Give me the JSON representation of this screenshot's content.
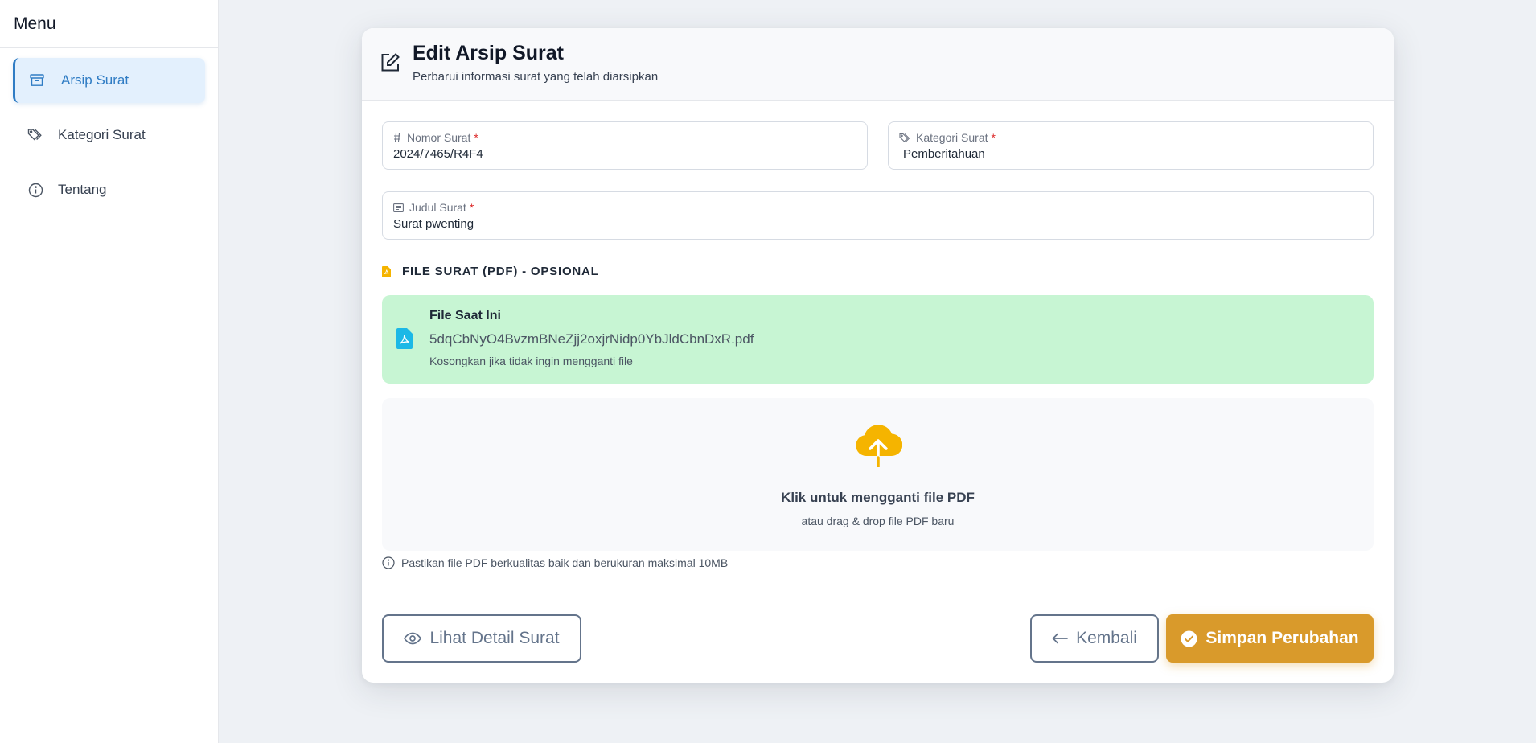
{
  "sidebar": {
    "title": "Menu",
    "items": [
      {
        "label": "Arsip Surat",
        "icon": "archive-icon",
        "active": true
      },
      {
        "label": "Kategori Surat",
        "icon": "tag-icon",
        "active": false
      },
      {
        "label": "Tentang",
        "icon": "info-icon",
        "active": false
      }
    ]
  },
  "header": {
    "title": "Edit Arsip Surat",
    "subtitle": "Perbarui informasi surat yang telah diarsipkan",
    "icon": "edit-icon"
  },
  "form": {
    "nomor": {
      "label": "Nomor Surat",
      "required_mark": "*",
      "value": "2024/7465/R4F4",
      "icon": "hash-icon"
    },
    "kategori": {
      "label": "Kategori Surat",
      "required_mark": "*",
      "value": "Pemberitahuan",
      "icon": "tag-icon"
    },
    "judul": {
      "label": "Judul Surat",
      "required_mark": "*",
      "value": "Surat pwenting",
      "icon": "text-icon"
    }
  },
  "file_section": {
    "label": "FILE SURAT (PDF) - OPSIONAL",
    "current": {
      "title": "File Saat Ini",
      "filename": "5dqCbNyO4BvzmBNeZjj2oxjrNidp0YbJldCbnDxR.pdf",
      "hint": "Kosongkan jika tidak ingin mengganti file"
    },
    "dropzone": {
      "title": "Klik untuk mengganti file PDF",
      "subtitle": "atau drag & drop file PDF baru"
    },
    "note": "Pastikan file PDF berkualitas baik dan berukuran maksimal 10MB"
  },
  "actions": {
    "detail_label": "Lihat Detail Surat",
    "back_label": "Kembali",
    "save_label": "Simpan Perubahan"
  },
  "colors": {
    "accent": "#2f7cc4",
    "save": "#d99a2b",
    "upload_icon": "#f5b400",
    "file_box": "#c7f5d3",
    "pdf_icon": "#1cb8e6"
  }
}
